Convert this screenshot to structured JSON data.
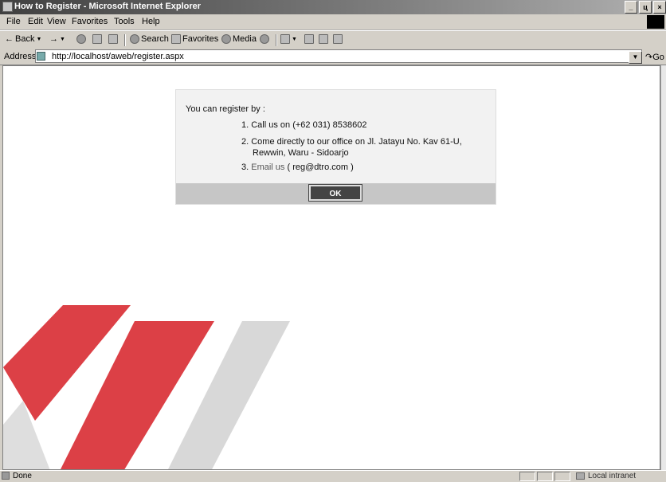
{
  "window": {
    "title": "How to Register - Microsoft Internet Explorer",
    "controls": [
      "_",
      "ц",
      "×"
    ]
  },
  "menu": {
    "items": [
      "File",
      "Edit",
      "View",
      "Favorites",
      "Tools",
      "Help"
    ]
  },
  "toolbar": {
    "back_label": "Back",
    "forward_arrow": "→",
    "back_arrow": "←",
    "search_label": "Search",
    "favorites_label": "Favorites",
    "media_label": "Media"
  },
  "address": {
    "label": "Address",
    "url": "http://localhost/aweb/register.aspx",
    "go_label": "Go"
  },
  "dialog": {
    "intro": "You can register by :",
    "option1": "1. Call us on (+62 031) 8538602",
    "option2_line1": "2. Come directly to our office on Jl. Jatayu No. Kav 61-U,",
    "option2_line2": "Rewwin, Waru - Sidoarjo",
    "option3_prefix": "3. ",
    "option3_link": "Email us",
    "option3_rest": " ( reg@dtro.com )",
    "ok_label": "OK"
  },
  "status": {
    "text": "Done",
    "zone": "Local intranet"
  },
  "colors": {
    "watermark_red": "#d61f26",
    "watermark_gray": "#c8c8c8"
  }
}
